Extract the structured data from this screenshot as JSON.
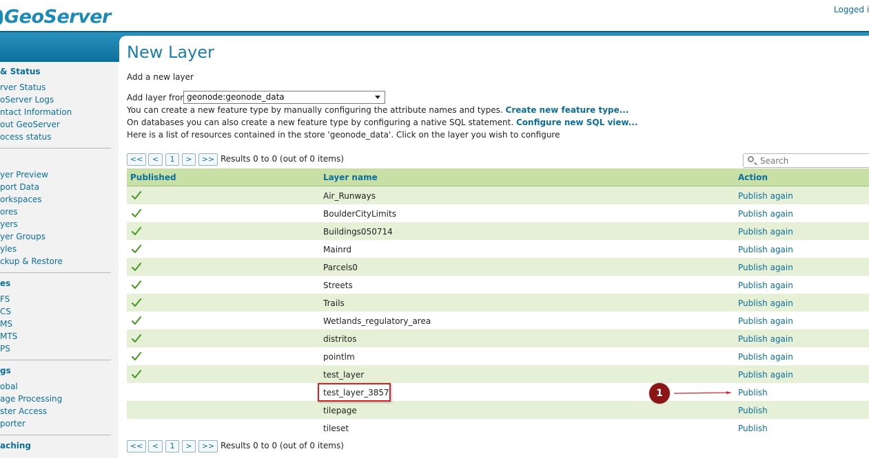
{
  "header": {
    "logo_text": "GeoServer",
    "logged_in_text": "Logged in"
  },
  "sidebar": {
    "sections": [
      {
        "title": "& Status",
        "items": [
          "rver Status",
          "oServer Logs",
          "ntact Information",
          "out GeoServer",
          "ocess status"
        ]
      },
      {
        "title": "",
        "items": [
          "yer Preview",
          "port Data",
          "orkspaces",
          "ores",
          "yers",
          "yer Groups",
          "yles",
          "ckup & Restore"
        ]
      },
      {
        "title": "es",
        "items": [
          "FS",
          "CS",
          "MS",
          "MTS",
          "PS"
        ]
      },
      {
        "title": "gs",
        "items": [
          "obal",
          "age Processing",
          "ster Access",
          "porter"
        ]
      },
      {
        "title": "aching",
        "items": []
      }
    ]
  },
  "main": {
    "title": "New Layer",
    "subtitle": "Add a new layer",
    "add_layer_label": "Add layer from",
    "store_select_value": "geonode:geonode_data",
    "info1_text": "You can create a new feature type by manually configuring the attribute names and types.",
    "info1_link": "Create new feature type...",
    "info2_text": "On databases you can also create a new feature type by configuring a native SQL statement.",
    "info2_link": "Configure new SQL view...",
    "info3_text": "Here is a list of resources contained in the store 'geonode_data'. Click on the layer you wish to configure"
  },
  "pager": {
    "first": "<<",
    "prev": "<",
    "page": "1",
    "next": ">",
    "last": ">>",
    "results_text": "Results 0 to 0 (out of 0 items)"
  },
  "search": {
    "placeholder": "Search"
  },
  "table": {
    "headers": {
      "published": "Published",
      "layer_name": "Layer name",
      "action": "Action"
    },
    "rows": [
      {
        "published": true,
        "name": "Air_Runways",
        "action": "Publish again"
      },
      {
        "published": true,
        "name": "BoulderCityLimits",
        "action": "Publish again"
      },
      {
        "published": true,
        "name": "Buildings050714",
        "action": "Publish again"
      },
      {
        "published": true,
        "name": "Mainrd",
        "action": "Publish again"
      },
      {
        "published": true,
        "name": "Parcels0",
        "action": "Publish again"
      },
      {
        "published": true,
        "name": "Streets",
        "action": "Publish again"
      },
      {
        "published": true,
        "name": "Trails",
        "action": "Publish again"
      },
      {
        "published": true,
        "name": "Wetlands_regulatory_area",
        "action": "Publish again"
      },
      {
        "published": true,
        "name": "distritos",
        "action": "Publish again"
      },
      {
        "published": true,
        "name": "pointlm",
        "action": "Publish again"
      },
      {
        "published": true,
        "name": "test_layer",
        "action": "Publish again"
      },
      {
        "published": false,
        "name": "test_layer_3857",
        "action": "Publish"
      },
      {
        "published": false,
        "name": "tilepage",
        "action": "Publish"
      },
      {
        "published": false,
        "name": "tileset",
        "action": "Publish"
      }
    ]
  },
  "annotation": {
    "badge_number": "1"
  },
  "colors": {
    "accent": "#0b6e9c",
    "header_band": "#1b8bb5",
    "row_alt": "#e6f0d6",
    "table_header": "#c8e0a5",
    "highlight": "#d2232a",
    "badge": "#8b1414"
  }
}
